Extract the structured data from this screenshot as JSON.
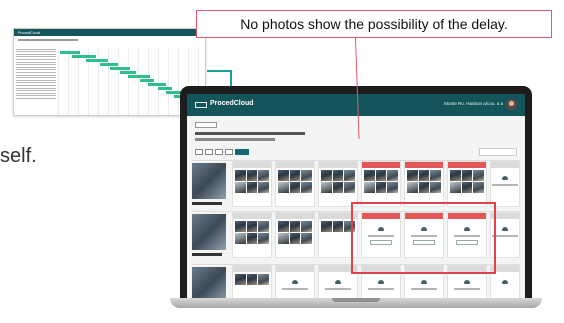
{
  "callout": {
    "text": "No photos show the possibility of the delay."
  },
  "caption": {
    "fragment": "self."
  },
  "app": {
    "name": "ProcedCloud",
    "user_label": "Monte Ro. Hanbon a/cou. a a",
    "back_label": "戻る",
    "section_count": 3
  },
  "inset": {
    "app_name": "ProcedCloud"
  },
  "colors": {
    "brand": "#13555b",
    "accent_teal": "#13a39b",
    "highlight_red": "#e0424e",
    "gantt_bar": "#2ec08a"
  },
  "icons": [
    "cloud-upload-icon",
    "avatar",
    "arrow-down-icon"
  ]
}
